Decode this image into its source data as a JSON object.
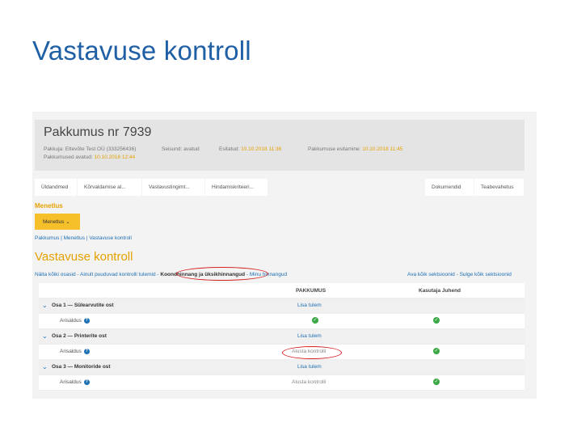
{
  "slide": {
    "title": "Vastavuse kontroll"
  },
  "header": {
    "title": "Pakkumus nr 7939",
    "pakkuja_label": "Pakkuja:",
    "pakkuja_value": "Ettevõte Test OÜ (333256436)",
    "seisund_label": "Seisund:",
    "seisund_value": "avatud",
    "esitatud_label": "Esitatud:",
    "esitatud_value": "10.10.2018 11:36",
    "estamine_label": "Pakkumuse esitamine:",
    "estamine_value": "10.10.2018 11:45",
    "avatud_label": "Pakkumused avatud:",
    "avatud_value": "10.10.2018 12:44"
  },
  "tabs_left": [
    "Üldandmed",
    "Kõrvaldamise al...",
    "Vastavustingimt...",
    "Hindamiskriteeri..."
  ],
  "tabs_right": [
    "Dokumendid",
    "Teabevahetus"
  ],
  "menu": {
    "label": "Menetlus",
    "button": "Menetlus",
    "chevron": "⌄"
  },
  "breadcrumb": "Pakkumus | Menetlus | Vastavuse kontroll",
  "page_heading": "Vastavuse kontroll",
  "filters": {
    "show_all": "Näita kõiki osasid",
    "sep1": " - ",
    "only_controlled": "Ainult puuduvad kontrolli tulemid",
    "sep2": " - ",
    "active": "Koondhinnang ja üksikhinnangud",
    "sep3": " - ",
    "mine": "Minu hinnangud"
  },
  "sections": {
    "open": "Ava kõik sektsioonid",
    "sep": " - ",
    "close": "Sulge kõik sektsioonid"
  },
  "table": {
    "col1": "PAKKUMUS",
    "col2": "Kasutaja Juhend",
    "groups": [
      {
        "name": "Osa 1 — Sülearvutite ost",
        "link": "Lisa tulem",
        "sub": "Arisaldus",
        "sub_value": "",
        "check1": true,
        "check2": true
      },
      {
        "name": "Osa 2 — Printerite ost",
        "link": "Lisa tulem",
        "sub": "Arisaldus",
        "sub_value": "Alusta kontrolli",
        "check1": false,
        "check2": true
      },
      {
        "name": "Osa 3 — Monitoride ost",
        "link": "Lisa tulem",
        "sub": "Arisaldus",
        "sub_value": "Alusta kontrolli",
        "check1": false,
        "check2": true
      }
    ]
  },
  "icons": {
    "chevron": "chevron-down-icon",
    "help": "help-icon",
    "check": "check-icon"
  },
  "colors": {
    "title": "#1f5fa5",
    "accent": "#e5a100",
    "link": "#1f6fb4",
    "check": "#3aa845",
    "annotation": "#d42020"
  }
}
